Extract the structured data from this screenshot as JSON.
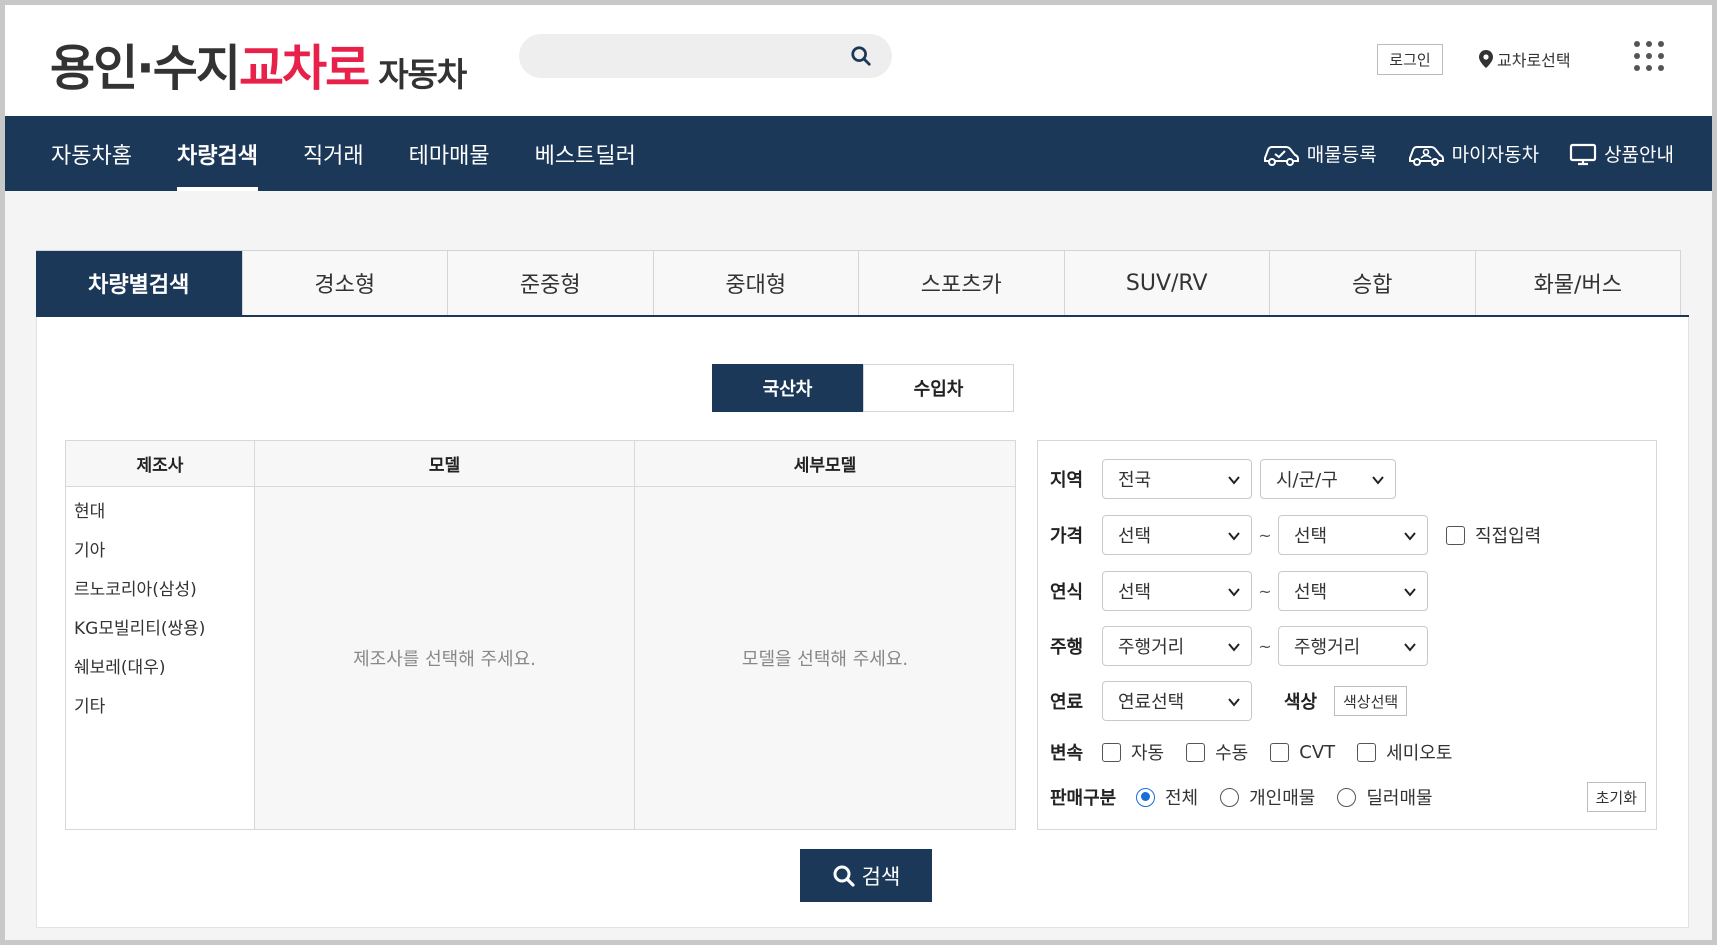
{
  "header": {
    "logo": {
      "part1": "용인·수지",
      "part2": "교차로",
      "part3": "자동차"
    },
    "search_placeholder": "",
    "login_label": "로그인",
    "region_label": "교차로선택"
  },
  "nav": {
    "items": [
      "자동차홈",
      "차량검색",
      "직거래",
      "테마매물",
      "베스트딜러"
    ],
    "active_index": 1,
    "utils": [
      "매물등록",
      "마이자동차",
      "상품안내"
    ]
  },
  "category_tabs": [
    "차량별검색",
    "경소형",
    "준중형",
    "중대형",
    "스포츠카",
    "SUV/RV",
    "승합",
    "화물/버스"
  ],
  "origin": {
    "domestic": "국산차",
    "imported": "수입차"
  },
  "selector": {
    "maker_header": "제조사",
    "model_header": "모델",
    "detail_header": "세부모델",
    "makers": [
      "현대",
      "기아",
      "르노코리아(삼성)",
      "KG모빌리티(쌍용)",
      "쉐보레(대우)",
      "기타"
    ],
    "model_placeholder": "제조사를 선택해 주세요.",
    "detail_placeholder": "모델을 선택해 주세요."
  },
  "filters": {
    "region": {
      "label": "지역",
      "sido": "전국",
      "sigungu": "시/군/구"
    },
    "price": {
      "label": "가격",
      "from": "선택",
      "tilde": "~",
      "to": "선택",
      "direct_input": "직접입력"
    },
    "year": {
      "label": "연식",
      "from": "선택",
      "tilde": "~",
      "to": "선택"
    },
    "mileage": {
      "label": "주행",
      "from": "주행거리",
      "tilde": "~",
      "to": "주행거리"
    },
    "fuel": {
      "label": "연료",
      "value": "연료선택"
    },
    "color": {
      "label": "색상",
      "button": "색상선택"
    },
    "transmission": {
      "label": "변속",
      "options": [
        "자동",
        "수동",
        "CVT",
        "세미오토"
      ]
    },
    "sale_type": {
      "label": "판매구분",
      "options": [
        "전체",
        "개인매물",
        "딜러매물"
      ],
      "selected": "전체"
    },
    "reset_label": "초기화"
  },
  "search_button": "검색",
  "colors": {
    "navy": "#1c3859",
    "brand_red": "#e8214b",
    "radio_blue": "#1a6ed8"
  }
}
